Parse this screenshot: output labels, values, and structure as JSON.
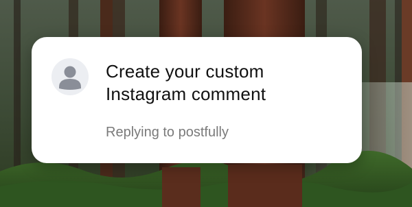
{
  "comment_card": {
    "title": "Create your custom Instagram comment",
    "replying_text": "Replying to postfully",
    "avatar_icon": "user-avatar-icon"
  }
}
